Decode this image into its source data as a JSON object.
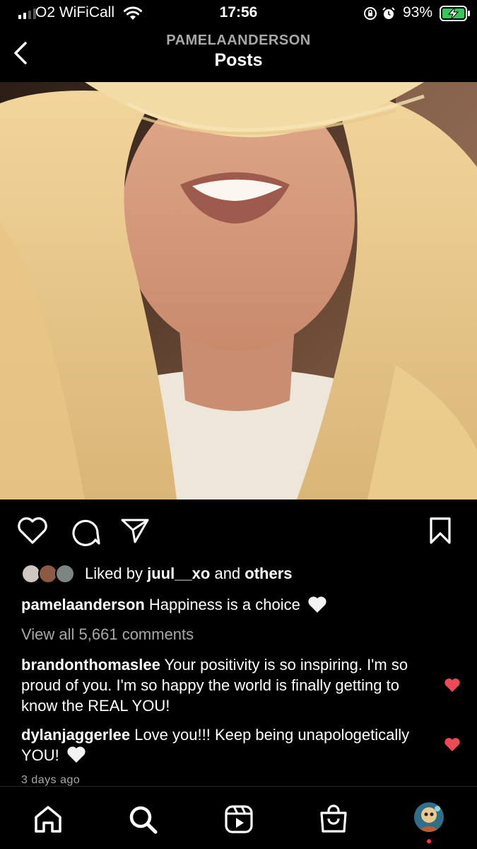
{
  "status": {
    "carrier": "O2 WiFiCall",
    "time": "17:56",
    "battery": "93%"
  },
  "header": {
    "username": "PAMELAANDERSON",
    "title": "Posts"
  },
  "post": {
    "liked_by_prefix": "Liked by",
    "liked_by_user": "juul__xo",
    "liked_by_and": "and",
    "liked_by_others": "others",
    "author": "pamelaanderson",
    "caption": "Happiness is a choice",
    "view_comments": "View all 5,661 comments",
    "time_ago": "3 days ago",
    "comments": [
      {
        "user": "brandonthomaslee",
        "text": "Your positivity is so inspiring. I'm so proud of you. I'm so happy the world is finally getting to know the REAL YOU!"
      },
      {
        "user": "dylanjaggerlee",
        "text": "Love you!!! Keep being unapologetically YOU!"
      }
    ]
  },
  "icons": {
    "back": "chevron-left-icon",
    "like": "heart-icon",
    "comment": "comment-icon",
    "share": "send-icon",
    "save": "bookmark-icon",
    "home": "home-icon",
    "search": "search-icon",
    "reels": "reels-icon",
    "shop": "shop-icon"
  },
  "colors": {
    "background": "#000000",
    "secondary_text": "#a8a8a8",
    "like_red": "#ed4956",
    "notification_dot": "#ff3040"
  }
}
